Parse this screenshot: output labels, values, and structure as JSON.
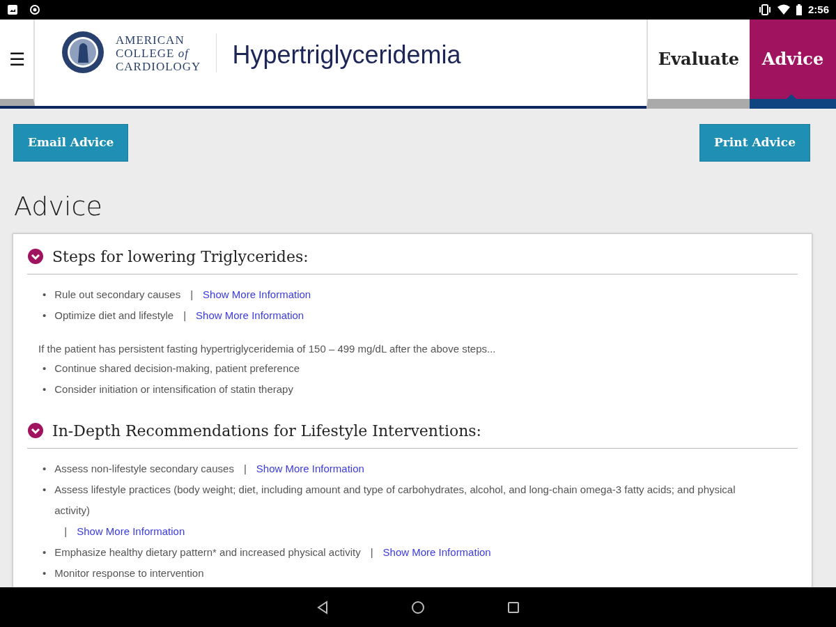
{
  "status_bar": {
    "time": "2:56"
  },
  "header": {
    "menu": "☰",
    "logo_lines": [
      "AMERICAN",
      "COLLEGE *of*",
      "CARDIOLOGY"
    ],
    "title": "Hypertriglyceridemia",
    "tabs": [
      {
        "label": "Evaluate",
        "selected": false
      },
      {
        "label": "Advice",
        "selected": true
      }
    ]
  },
  "actions": [
    {
      "label": "Email Advice"
    },
    {
      "label": "Print Advice"
    }
  ],
  "page_title": "Advice",
  "sections": [
    {
      "title": "Steps for lowering Triglycerides:",
      "expanded": true,
      "blocks": [
        {
          "kind": "bullet",
          "marker": "•",
          "text": "Rule out secondary causes",
          "separator": "|",
          "link": "Show More Information"
        },
        {
          "kind": "bullet",
          "marker": "•",
          "text": "Optimize diet and lifestyle",
          "separator": "|",
          "link": "Show More Information"
        },
        {
          "kind": "note",
          "text": "If the patient has persistent fasting hypertriglyceridemia of 150 – 499 mg/dL after the above steps..."
        },
        {
          "kind": "bullet",
          "marker": "•",
          "text": "Continue shared decision-making, patient preference"
        },
        {
          "kind": "bullet",
          "marker": "•",
          "text": "Consider initiation or intensification of statin therapy"
        }
      ]
    },
    {
      "title": "In-Depth Recommendations for Lifestyle Interventions:",
      "expanded": true,
      "blocks": [
        {
          "kind": "bullet",
          "marker": "•",
          "text": "Assess non-lifestyle secondary causes",
          "separator": "|",
          "link": "Show More Information"
        },
        {
          "kind": "bullet",
          "marker": "•",
          "text": "Assess lifestyle practices (body weight; diet, including amount and type of carbohydrates, alcohol, and long-chain omega-3 fatty acids; and physical activity)",
          "separator": "|",
          "link": "Show More Information"
        },
        {
          "kind": "bullet",
          "marker": "•",
          "text": "Emphasize healthy dietary pattern* and increased physical activity",
          "separator": "|",
          "link": "Show More Information"
        },
        {
          "kind": "bullet",
          "marker": "•",
          "text": "Monitor response to intervention"
        }
      ]
    }
  ]
}
